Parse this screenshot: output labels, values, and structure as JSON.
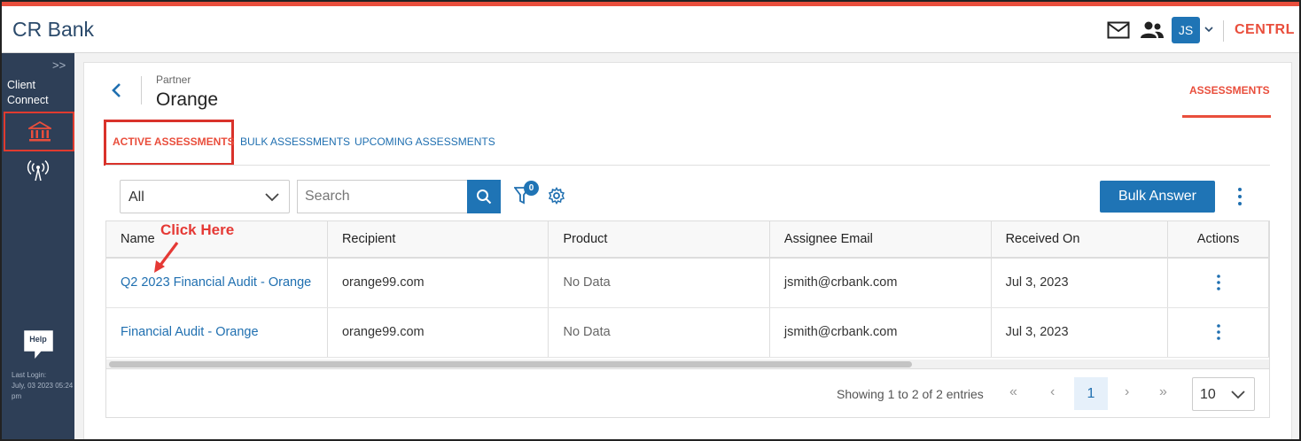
{
  "app": {
    "title": "CR Bank",
    "brand": "CENTRL",
    "user_initials": "JS",
    "accent_color": "#e94e3c",
    "primary_color": "#1f74b5"
  },
  "header": {
    "icons": [
      "mail-icon",
      "people-icon",
      "chevron-down-icon"
    ]
  },
  "sidebar": {
    "section_label": "Client Connect",
    "items": [
      {
        "icon": "bank-icon",
        "selected": true
      },
      {
        "icon": "broadcast-icon",
        "selected": false
      }
    ],
    "help_label": "Help",
    "last_login_label": "Last Login:",
    "last_login_value": "July, 03 2023 05:24 pm"
  },
  "page": {
    "breadcrumb_label": "Partner",
    "title": "Orange",
    "main_tab": "ASSESSMENTS"
  },
  "subtabs": [
    {
      "label": "ACTIVE ASSESSMENTS",
      "active": true
    },
    {
      "label": "BULK ASSESSMENTS",
      "active": false
    },
    {
      "label": "UPCOMING ASSESSMENTS",
      "active": false
    }
  ],
  "toolbar": {
    "status_filter": "All",
    "search_placeholder": "Search",
    "filter_count": "0",
    "bulk_answer_label": "Bulk Answer"
  },
  "table": {
    "columns": [
      "Name",
      "Recipient",
      "Product",
      "Assignee Email",
      "Received On",
      "Actions"
    ],
    "rows": [
      {
        "name": "Q2 2023 Financial Audit - Orange",
        "recipient": "orange99.com",
        "product": "No Data",
        "assignee_email": "jsmith@crbank.com",
        "received_on": "Jul 3, 2023"
      },
      {
        "name": "Financial Audit - Orange",
        "recipient": "orange99.com",
        "product": "No Data",
        "assignee_email": "jsmith@crbank.com",
        "received_on": "Jul 3, 2023"
      }
    ]
  },
  "annotation": {
    "text": "Click Here",
    "color": "#e53935"
  },
  "pagination": {
    "info": "Showing 1 to 2 of 2 entries",
    "current_page": "1",
    "page_size": "10",
    "first": "«",
    "prev": "‹",
    "next": "›",
    "last": "»"
  }
}
